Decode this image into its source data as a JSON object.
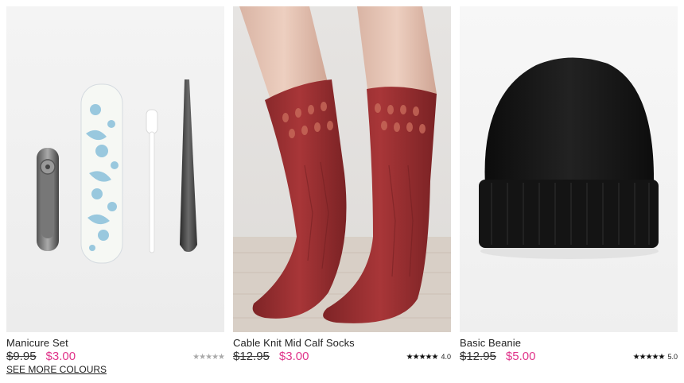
{
  "products": [
    {
      "name": "Manicure Set",
      "old_price": "$9.95",
      "new_price": "$3.00",
      "rating_stars": "★★★★★",
      "rating_value": "",
      "rating_empty": true,
      "more_link": "SEE MORE COLOURS",
      "image_icon": "manicure-set-image"
    },
    {
      "name": "Cable Knit Mid Calf Socks",
      "old_price": "$12.95",
      "new_price": "$3.00",
      "rating_stars": "★★★★★",
      "rating_value": "4.0",
      "image_icon": "socks-image"
    },
    {
      "name": "Basic Beanie",
      "old_price": "$12.95",
      "new_price": "$5.00",
      "rating_stars": "★★★★★",
      "rating_value": "5.0",
      "image_icon": "beanie-image"
    }
  ],
  "colors": {
    "sale_price": "#e0358b",
    "beanie": "#151515",
    "socks": "#9e2f2f"
  }
}
